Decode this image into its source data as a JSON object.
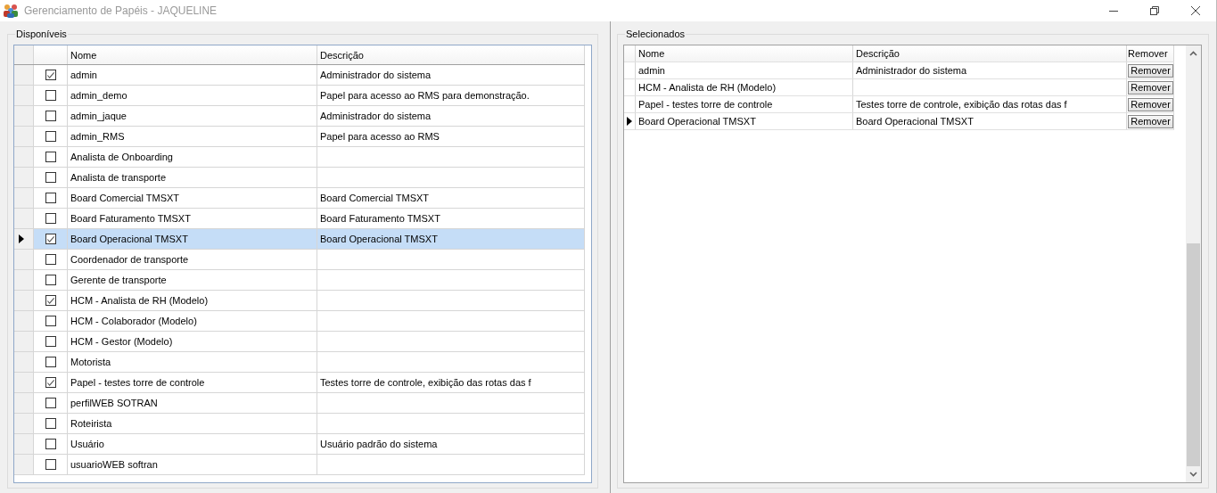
{
  "window": {
    "title": "Gerenciamento de Papéis - JAQUELINE"
  },
  "available": {
    "legend": "Disponíveis",
    "columns": [
      "Nome",
      "Descrição"
    ],
    "rows": [
      {
        "name": "admin",
        "description": "Administrador do sistema",
        "checked": true,
        "selected": false
      },
      {
        "name": "admin_demo",
        "description": "Papel para acesso ao RMS para demonstração.",
        "checked": false,
        "selected": false
      },
      {
        "name": "admin_jaque",
        "description": "Administrador do sistema",
        "checked": false,
        "selected": false
      },
      {
        "name": "admin_RMS",
        "description": "Papel para acesso ao RMS",
        "checked": false,
        "selected": false
      },
      {
        "name": "Analista de Onboarding",
        "checked": false,
        "selected": false
      },
      {
        "name": "Analista de transporte",
        "checked": false,
        "selected": false
      },
      {
        "name": "Board Comercial TMSXT",
        "description": "Board Comercial TMSXT",
        "checked": false,
        "selected": false
      },
      {
        "name": "Board Faturamento TMSXT",
        "description": "Board Faturamento TMSXT",
        "checked": false,
        "selected": false
      },
      {
        "name": "Board Operacional TMSXT",
        "description": "Board Operacional TMSXT",
        "checked": true,
        "selected": true
      },
      {
        "name": "Coordenador de transporte",
        "checked": false,
        "selected": false
      },
      {
        "name": "Gerente de transporte",
        "checked": false,
        "selected": false
      },
      {
        "name": "HCM - Analista de RH (Modelo)",
        "checked": true,
        "selected": false
      },
      {
        "name": "HCM - Colaborador (Modelo)",
        "checked": false,
        "selected": false
      },
      {
        "name": "HCM - Gestor (Modelo)",
        "checked": false,
        "selected": false
      },
      {
        "name": "Motorista",
        "checked": false,
        "selected": false
      },
      {
        "name": "Papel - testes torre de controle",
        "description": "Testes torre de controle, exibição das rotas das f",
        "checked": true,
        "selected": false
      },
      {
        "name": "perfilWEB SOTRAN",
        "checked": false,
        "selected": false
      },
      {
        "name": "Roteirista",
        "checked": false,
        "selected": false
      },
      {
        "name": "Usuário",
        "description": "Usuário padrão do sistema",
        "checked": false,
        "selected": false
      },
      {
        "name": "usuarioWEB softran",
        "checked": false,
        "selected": false
      }
    ]
  },
  "chosen": {
    "legend": "Selecionados",
    "columns": [
      "Nome",
      "Descrição",
      "Remover"
    ],
    "rows": [
      {
        "name": "admin",
        "description": "Administrador do sistema",
        "button": "Remover",
        "selected": false
      },
      {
        "name": "HCM - Analista de RH (Modelo)",
        "button": "Remover",
        "selected": false
      },
      {
        "name": "Papel - testes torre de controle",
        "description": "Testes torre de controle, exibição das rotas das f",
        "button": "Remover",
        "selected": false
      },
      {
        "name": "Board Operacional TMSXT",
        "description": "Board Operacional TMSXT",
        "button": "Remover",
        "selected": true
      }
    ]
  }
}
